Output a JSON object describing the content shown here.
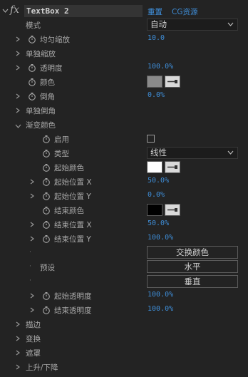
{
  "header": {
    "fx_label": "fx",
    "layer_name": "TextBox 2",
    "reset_label": "重置",
    "cg_label": "CG资源"
  },
  "props": {
    "mode": {
      "label": "模式",
      "value": "自动"
    },
    "uniform_scale": {
      "label": "均匀缩放",
      "value": "10.0"
    },
    "separate_scale": {
      "label": "单独缩放"
    },
    "opacity": {
      "label": "透明度",
      "value": "100.0%"
    },
    "color": {
      "label": "颜色",
      "swatch": "#8a8a8a"
    },
    "corner": {
      "label": "倒角",
      "value": "0.0%"
    },
    "separate_corner": {
      "label": "单独倒角"
    },
    "gradient": {
      "label": "渐变颜色"
    }
  },
  "gradient": {
    "enable": {
      "label": "启用"
    },
    "type": {
      "label": "类型",
      "value": "线性"
    },
    "start_color": {
      "label": "起始颜色",
      "swatch": "#ffffff"
    },
    "start_x": {
      "label": "起始位置 X",
      "value": "50.0%"
    },
    "start_y": {
      "label": "起始位置 Y",
      "value": "0.0%"
    },
    "end_color": {
      "label": "结束颜色",
      "swatch": "#000000"
    },
    "end_x": {
      "label": "结束位置 X",
      "value": "50.0%"
    },
    "end_y": {
      "label": "结束位置 Y",
      "value": "100.0%"
    },
    "swap_button": "交换颜色",
    "preset_label": "预设",
    "horizontal_button": "水平",
    "vertical_button": "垂直",
    "start_opacity": {
      "label": "起始透明度",
      "value": "100.0%"
    },
    "end_opacity": {
      "label": "结束透明度",
      "value": "100.0%"
    }
  },
  "groups": {
    "stroke": "描边",
    "transform": "变换",
    "mask": "遮罩",
    "rise_fall": "上升/下降"
  },
  "colors": {
    "accent": "#3f8ed8",
    "panel_bg": "#232323"
  }
}
